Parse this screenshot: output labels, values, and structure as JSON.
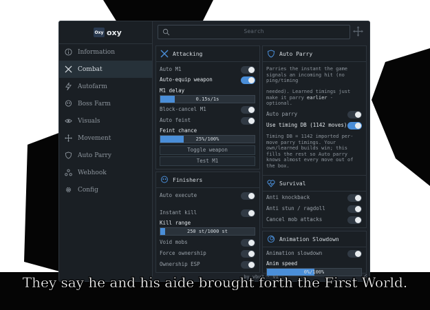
{
  "app": {
    "logo_mark": "Oxy",
    "name": "oxy",
    "footer": "by vbu3 · v1"
  },
  "search": {
    "placeholder": "Search"
  },
  "sidebar": {
    "items": [
      {
        "label": "Information",
        "icon": "info-icon"
      },
      {
        "label": "Combat",
        "icon": "swords-icon",
        "active": true
      },
      {
        "label": "Autofarm",
        "icon": "lightning-icon"
      },
      {
        "label": "Boss Farm",
        "icon": "skull-icon"
      },
      {
        "label": "Visuals",
        "icon": "eye-icon"
      },
      {
        "label": "Movement",
        "icon": "move-icon"
      },
      {
        "label": "Auto Parry",
        "icon": "shield-icon"
      },
      {
        "label": "Webhook",
        "icon": "webhook-icon"
      },
      {
        "label": "Config",
        "icon": "gear-icon"
      }
    ]
  },
  "attacking": {
    "title": "Attacking",
    "auto_m1": "Auto M1",
    "auto_equip": "Auto-equip weapon",
    "m1_delay": "M1 delay",
    "m1_delay_value": "0.15s/1s",
    "m1_delay_fraction": 0.15,
    "block_cancel": "Block-cancel M1",
    "auto_feint": "Auto feint",
    "feint_chance": "Feint chance",
    "feint_value": "25%/100%",
    "feint_fraction": 0.25,
    "toggle_weapon": "Toggle weapon",
    "test_m1": "Test M1"
  },
  "finishers": {
    "title": "Finishers",
    "auto_execute": "Auto execute",
    "instant_kill": "Instant kill",
    "kill_range": "Kill range",
    "kill_range_value": "250 st/1000 st",
    "kill_range_fraction": 0.05,
    "void_mobs": "Void mobs",
    "force_ownership": "Force ownership",
    "ownership_esp": "Ownership ESP"
  },
  "auto_parry": {
    "title": "Auto Parry",
    "desc1": "Parries the instant the game signals an incoming hit (no ping/timing",
    "desc2a": "needed). Learned timings just make it parry ",
    "desc2b": "earlier",
    "desc2c": " - optional.",
    "auto_parry": "Auto parry",
    "use_timing": "Use timing DB (1142 moves)",
    "desc3": "Timing DB = 1142 imported per-move parry timings. Your own/learned builds win; this fills the rest so Auto parry knows almost every move out of the box."
  },
  "survival": {
    "title": "Survival",
    "anti_knockback": "Anti knockback",
    "anti_stun": "Anti stun / ragdoll",
    "cancel_mob": "Cancel mob attacks"
  },
  "anim": {
    "title": "Animation Slowdown",
    "anim_slowdown": "Animation slowdown",
    "anim_speed": "Anim speed",
    "anim_speed_value": "0%/100%",
    "anim_speed_fraction": 0.5
  },
  "caption": "They say he and his aide brought forth the First World."
}
